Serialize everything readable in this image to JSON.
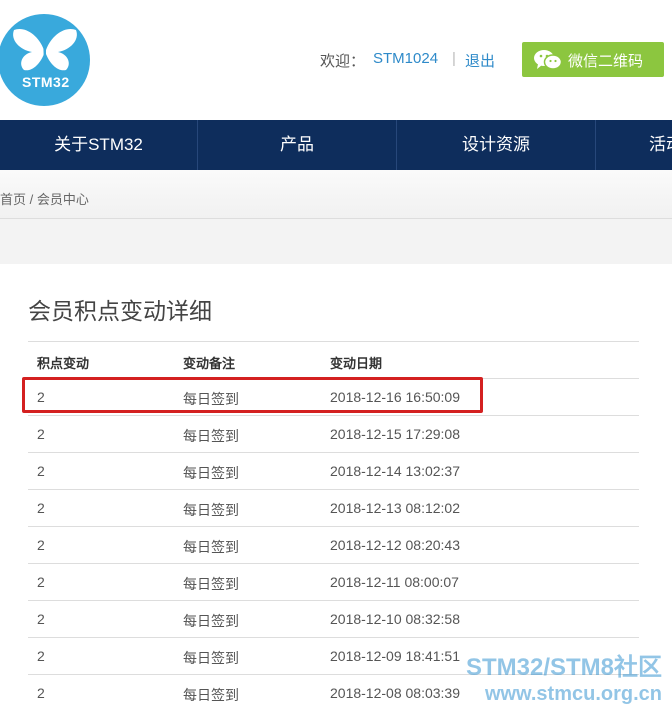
{
  "header": {
    "logo_text": "STM32",
    "welcome_label": "欢迎：",
    "username": "STM1024",
    "separator": "|",
    "logout_label": "退出",
    "wechat_button_label": "微信二维码",
    "wechat_icon": "wechat-icon"
  },
  "nav": {
    "items": [
      {
        "label": "关于STM32"
      },
      {
        "label": "产品"
      },
      {
        "label": "设计资源"
      },
      {
        "label": "活动"
      }
    ]
  },
  "breadcrumb": {
    "home": "首页",
    "separator": "/",
    "current": "会员中心"
  },
  "main": {
    "title": "会员积点变动详细",
    "columns": [
      "积点变动",
      "变动备注",
      "变动日期"
    ],
    "rows": [
      {
        "points": "2",
        "note": "每日签到",
        "date": "2018-12-16 16:50:09"
      },
      {
        "points": "2",
        "note": "每日签到",
        "date": "2018-12-15 17:29:08"
      },
      {
        "points": "2",
        "note": "每日签到",
        "date": "2018-12-14 13:02:37"
      },
      {
        "points": "2",
        "note": "每日签到",
        "date": "2018-12-13 08:12:02"
      },
      {
        "points": "2",
        "note": "每日签到",
        "date": "2018-12-12 08:20:43"
      },
      {
        "points": "2",
        "note": "每日签到",
        "date": "2018-12-11 08:00:07"
      },
      {
        "points": "2",
        "note": "每日签到",
        "date": "2018-12-10 08:32:58"
      },
      {
        "points": "2",
        "note": "每日签到",
        "date": "2018-12-09 18:41:51"
      },
      {
        "points": "2",
        "note": "每日签到",
        "date": "2018-12-08 08:03:39"
      }
    ]
  },
  "watermark": {
    "line1": "STM32/STM8社区",
    "line2": "www.stmcu.org.cn"
  },
  "colors": {
    "nav_bg": "#0e2d5c",
    "logo_bg": "#39a9dc",
    "link": "#2e8ac9",
    "wechat_bg": "#8cc63f",
    "highlight": "#d42020"
  }
}
